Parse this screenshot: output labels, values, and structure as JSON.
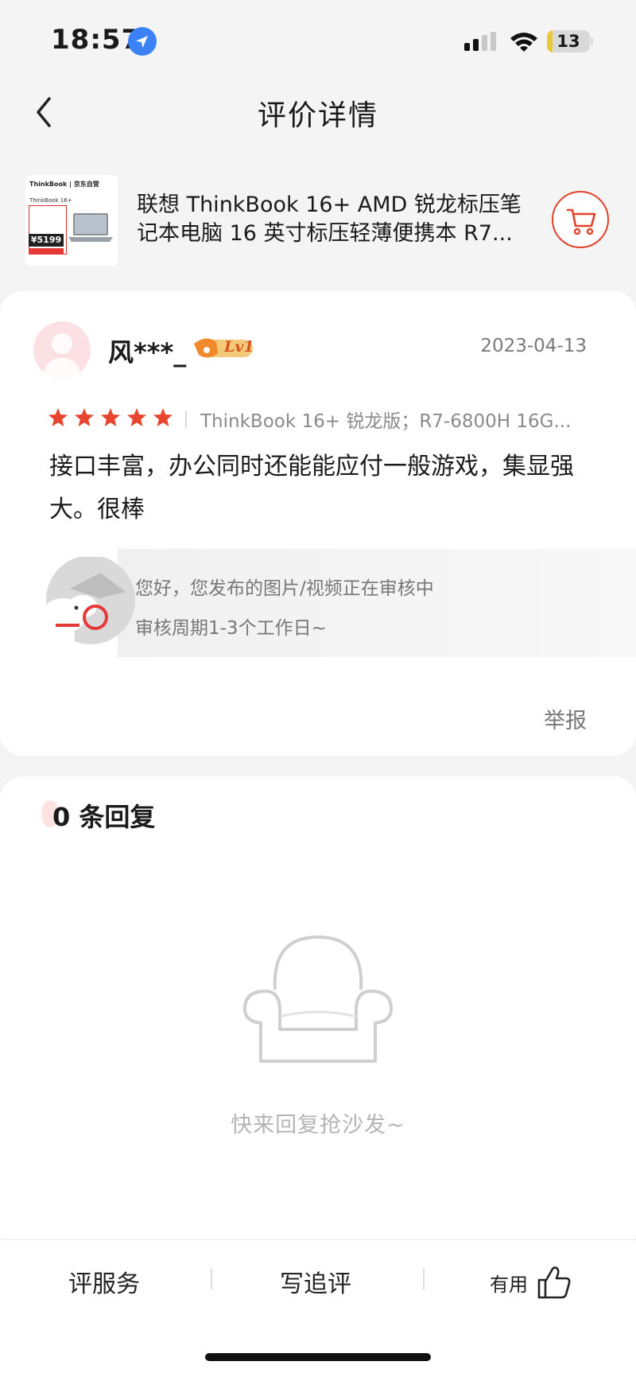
{
  "status_bar": {
    "time": "18:57",
    "battery_level": "13",
    "battery_fraction": 0.13,
    "battery_color": "#e9c93a"
  },
  "nav": {
    "title": "评价详情",
    "back_icon": "chevron-left-icon"
  },
  "product": {
    "thumbnail_brand": "ThinkBook | 京东自营",
    "thumbnail_model": "ThinkBook 16+",
    "thumbnail_price": "¥5199",
    "name": "联想 ThinkBook 16+ AMD 锐龙标压笔记本电脑 16 英寸标压轻薄便携本 R7...",
    "cart_icon": "shopping-cart-icon",
    "accent_color": "#e2412a"
  },
  "review": {
    "username": "风***_",
    "level_badge": "Lv1",
    "date": "2023-04-13",
    "rating": 5,
    "rating_max": 5,
    "star_color": "#e8452e",
    "spec": "ThinkBook 16+ 锐龙版；R7-6800H 16G...",
    "content": "接口丰富，办公同时还能能应付一般游戏，集显强大。很棒",
    "pending_line1": "您好，您发布的图片/视频正在审核中",
    "pending_line2": "审核周期1-3个工作日~",
    "report_label": "举报"
  },
  "replies": {
    "count_label": "0 条回复",
    "empty_text": "快来回复抢沙发~",
    "empty_icon": "sofa-icon"
  },
  "bottom_bar": {
    "service_label": "评服务",
    "followup_label": "写追评",
    "useful_label": "有用",
    "useful_icon": "thumbs-up-icon"
  }
}
